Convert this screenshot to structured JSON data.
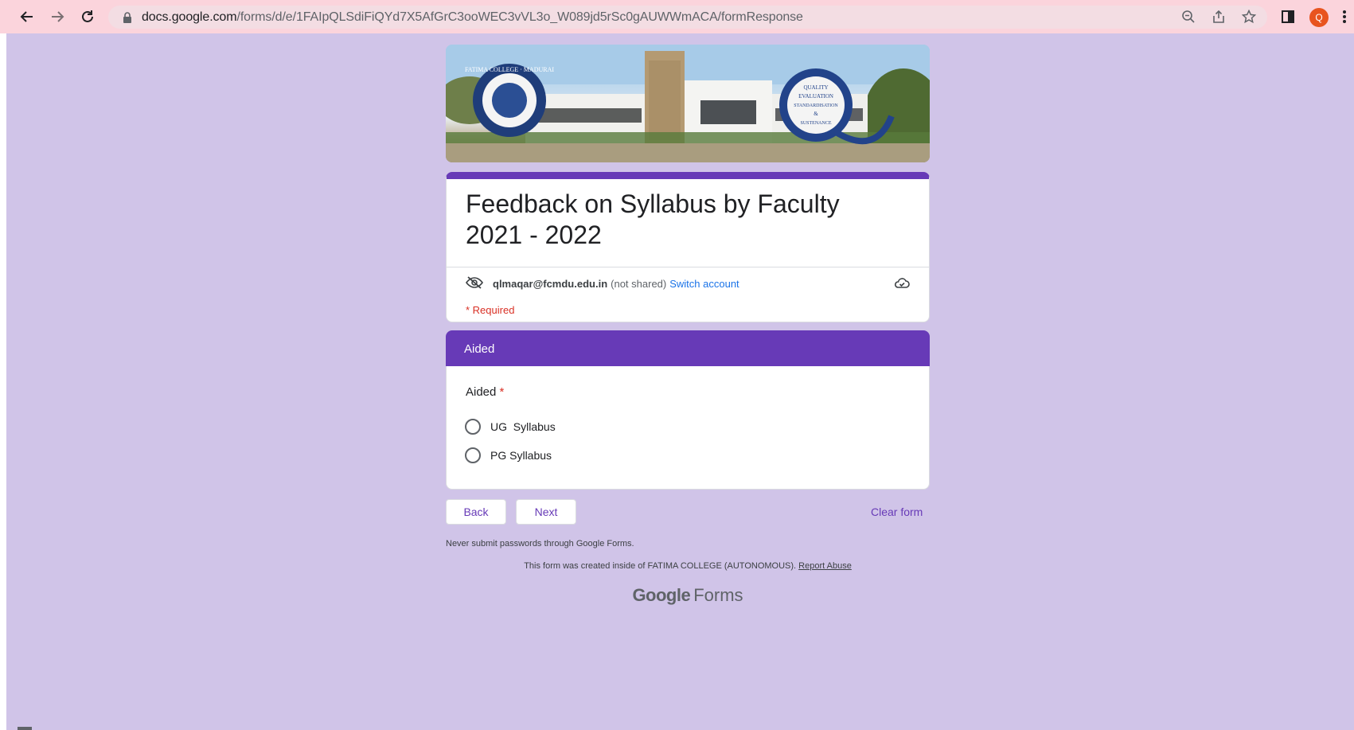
{
  "browser": {
    "url_host": "docs.google.com",
    "url_path": "/forms/d/e/1FAIpQLSdiFiQYd7X5AfGrC3ooWEC3vVL3o_W089jd5rSc0gAUWWmACA/formResponse",
    "avatar_letter": "Q",
    "icons": [
      "back-arrow-icon",
      "forward-arrow-icon",
      "reload-icon",
      "lock-icon",
      "zoom-icon",
      "share-icon",
      "star-icon",
      "side-panel-icon",
      "more-vert-icon"
    ],
    "accent_color": "#e8541e"
  },
  "banner": {
    "left_seal_text": "FATIMA COLLEGE · MADURAI",
    "right_seal_lines": [
      "QUALITY",
      "EVALUATION",
      "STANDARDISATION",
      "&",
      "SUSTENANCE"
    ]
  },
  "form": {
    "title": "Feedback on Syllabus by Faculty 2021 - 2022",
    "account_email": "qlmaqar@fcmdu.edu.in",
    "not_shared": "(not shared)",
    "switch_account": "Switch account",
    "required_note": "* Required",
    "theme_color": "#673ab7",
    "background_color": "#d0c4e8"
  },
  "section": {
    "header": "Aided",
    "question": "Aided",
    "required_star": "*",
    "options": [
      "UG  Syllabus",
      "PG Syllabus"
    ]
  },
  "actions": {
    "back": "Back",
    "next": "Next",
    "clear": "Clear form"
  },
  "footer": {
    "never_submit": "Never submit passwords through Google Forms.",
    "created_inside": "This form was created inside of FATIMA COLLEGE (AUTONOMOUS).",
    "report_abuse": "Report Abuse",
    "brand_google": "Google",
    "brand_forms": "Forms"
  }
}
